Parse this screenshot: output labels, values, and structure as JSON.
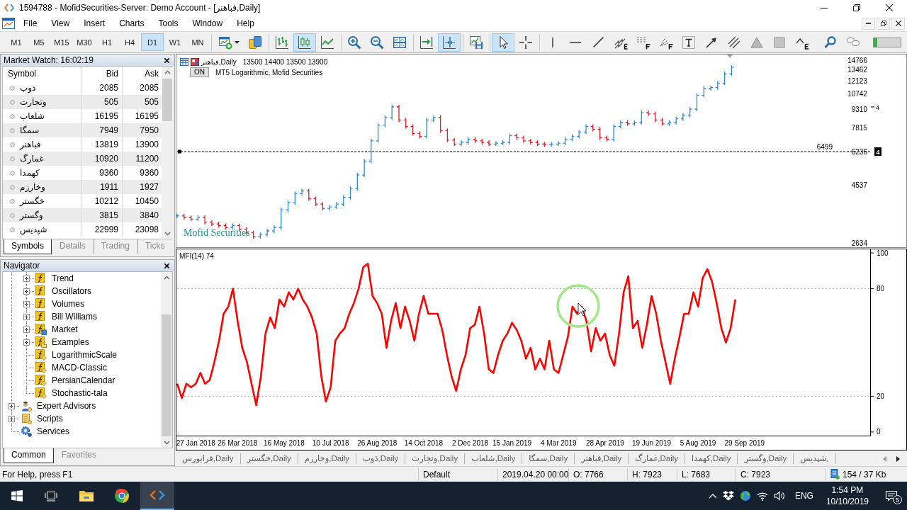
{
  "window": {
    "title": "1594788 - MofidSecurities-Server: Demo Account - [فباهنر,Daily]"
  },
  "menu": [
    "File",
    "View",
    "Insert",
    "Charts",
    "Tools",
    "Window",
    "Help"
  ],
  "toolbar": {
    "timeframes": [
      {
        "label": "M1",
        "selected": false
      },
      {
        "label": "M5",
        "selected": false
      },
      {
        "label": "M15",
        "selected": false
      },
      {
        "label": "M30",
        "selected": false
      },
      {
        "label": "H1",
        "selected": false
      },
      {
        "label": "H4",
        "selected": false
      },
      {
        "label": "D1",
        "selected": true
      },
      {
        "label": "W1",
        "selected": false
      },
      {
        "label": "MN",
        "selected": false
      }
    ],
    "tool_groups": [
      [
        {
          "kind": "new-chart",
          "selected": false
        },
        {
          "kind": "coins",
          "selected": false
        }
      ],
      [
        {
          "kind": "bar-chart",
          "selected": false
        },
        {
          "kind": "candles",
          "selected": true
        },
        {
          "kind": "line-chart",
          "selected": false
        }
      ],
      [
        {
          "kind": "zoom-in",
          "selected": false
        },
        {
          "kind": "zoom-out",
          "selected": false
        },
        {
          "kind": "tile",
          "selected": false
        }
      ],
      [
        {
          "kind": "shift",
          "selected": false
        },
        {
          "kind": "autoscroll",
          "selected": true
        }
      ],
      [
        {
          "kind": "templates",
          "selected": false
        }
      ],
      [
        {
          "kind": "cursor",
          "selected": true
        },
        {
          "kind": "crosshair",
          "selected": false
        }
      ],
      [
        {
          "kind": "vline",
          "selected": false
        },
        {
          "kind": "hline",
          "selected": false
        },
        {
          "kind": "trend",
          "selected": false
        },
        {
          "kind": "channel",
          "selected": false
        },
        {
          "kind": "fibo",
          "selected": false
        },
        {
          "kind": "fan",
          "selected": false
        },
        {
          "kind": "text",
          "selected": false
        },
        {
          "kind": "arrow",
          "selected": false
        },
        {
          "kind": "parallel",
          "selected": false
        },
        {
          "kind": "triangle",
          "selected": false
        },
        {
          "kind": "rectangle",
          "selected": false
        },
        {
          "kind": "elliott",
          "selected": false
        },
        {
          "kind": "search",
          "selected": false
        },
        {
          "kind": "chat",
          "selected": false
        }
      ]
    ]
  },
  "market_watch": {
    "title": "Market Watch: 16:02:19",
    "columns": [
      "Symbol",
      "Bid",
      "Ask"
    ],
    "rows": [
      {
        "symbol": "ذوب",
        "bid": "2085",
        "ask": "2085"
      },
      {
        "symbol": "وتجارت",
        "bid": "505",
        "ask": "505"
      },
      {
        "symbol": "شلعاب",
        "bid": "16195",
        "ask": "16195"
      },
      {
        "symbol": "سمگا",
        "bid": "7949",
        "ask": "7950"
      },
      {
        "symbol": "فباهنر",
        "bid": "13819",
        "ask": "13900"
      },
      {
        "symbol": "غمارگ",
        "bid": "10920",
        "ask": "11200"
      },
      {
        "symbol": "کهمدا",
        "bid": "9360",
        "ask": "9360"
      },
      {
        "symbol": "وخارزم",
        "bid": "1911",
        "ask": "1927"
      },
      {
        "symbol": "خگستر",
        "bid": "10212",
        "ask": "10450"
      },
      {
        "symbol": "وگستر",
        "bid": "3815",
        "ask": "3840"
      },
      {
        "symbol": "شپدیس",
        "bid": "22999",
        "ask": "23098"
      }
    ],
    "tabs": [
      {
        "label": "Symbols",
        "selected": true
      },
      {
        "label": "Details",
        "selected": false
      },
      {
        "label": "Trading",
        "selected": false
      },
      {
        "label": "Ticks",
        "selected": false
      }
    ]
  },
  "navigator": {
    "title": "Navigator",
    "tree": [
      {
        "children": [
          {
            "label": "Trend",
            "kind": "group",
            "expanded": false
          },
          {
            "label": "Oscillators",
            "kind": "group",
            "expanded": false
          },
          {
            "label": "Volumes",
            "kind": "group",
            "expanded": false
          },
          {
            "label": "Bill Williams",
            "kind": "group",
            "expanded": false
          },
          {
            "label": "Market",
            "kind": "market",
            "expanded": false
          },
          {
            "label": "Examples",
            "kind": "folder",
            "expanded": false
          },
          {
            "label": "LogarithmicScale",
            "kind": "indicator"
          },
          {
            "label": "MACD-Classic",
            "kind": "indicator"
          },
          {
            "label": "PersianCalendar",
            "kind": "indicator"
          },
          {
            "label": "Stochastic-tala",
            "kind": "indicator"
          }
        ]
      },
      {
        "label": "Expert Advisors",
        "kind": "experts",
        "expanded": false
      },
      {
        "label": "Scripts",
        "kind": "scripts",
        "expanded": false
      },
      {
        "label": "Services",
        "kind": "services"
      }
    ],
    "tabs": [
      {
        "label": "Common",
        "selected": true
      },
      {
        "label": "Favorites",
        "selected": false
      }
    ]
  },
  "chart": {
    "header": {
      "symbol": "فباهنر,Daily",
      "prices": "13500 14400 13500 13900",
      "button": "ON",
      "indicator": "MT5 Logarithmic, Mofid Securities"
    },
    "label": "Mofid Securities",
    "price_labels": [
      "14766",
      "13462",
      "12123",
      "10742",
      "9310",
      "7815",
      "6236",
      "4537",
      "2634"
    ],
    "line_label": "6499",
    "line_marker": "4",
    "axis_marker": "4"
  },
  "indicator": {
    "label": "MFI(14) 74",
    "chart_data": {
      "type": "line",
      "ylim": [
        -2.2,
        102
      ],
      "yticks": [
        0,
        20,
        80,
        100
      ],
      "ref_lines": [
        {
          "axis": "y",
          "value": 20
        },
        {
          "axis": "y",
          "value": 80
        }
      ],
      "categories": [
        null,
        null,
        null,
        null,
        "27 Jan 2018",
        null,
        null,
        null,
        null,
        null,
        null,
        null,
        null,
        "26 Mar 2018",
        null,
        null,
        null,
        null,
        null,
        null,
        null,
        null,
        null,
        "16 May 2018",
        null,
        null,
        null,
        null,
        null,
        null,
        null,
        null,
        null,
        "10 Jul 2018",
        null,
        null,
        null,
        null,
        null,
        null,
        null,
        null,
        null,
        "26 Aug 2018",
        null,
        null,
        null,
        null,
        null,
        null,
        null,
        null,
        null,
        "14 Oct 2018",
        null,
        null,
        null,
        null,
        null,
        null,
        null,
        null,
        null,
        "2 Dec 2018",
        null,
        null,
        null,
        null,
        null,
        null,
        null,
        null,
        "15 Jan 2019",
        null,
        null,
        null,
        null,
        null,
        null,
        null,
        null,
        null,
        "4 Mar 2019",
        null,
        null,
        null,
        null,
        null,
        null,
        null,
        null,
        null,
        "28 Apr 2019",
        null,
        null,
        null,
        null,
        null,
        null,
        null,
        null,
        null,
        "19 Jun 2019",
        null,
        null,
        null,
        null,
        null,
        null,
        null,
        null,
        null,
        "5 Aug 2019",
        null,
        null,
        null,
        null,
        null,
        null,
        null,
        null,
        null,
        "29 Sep 2019",
        null,
        null,
        null,
        null,
        null,
        null,
        null,
        null,
        null,
        null,
        null,
        null,
        null,
        null,
        null,
        null,
        null,
        null,
        null,
        null,
        null,
        null,
        null,
        null,
        null,
        null,
        null
      ],
      "series": [
        {
          "color": "#ff0000",
          "values": [
            27,
            19,
            27,
            25,
            27,
            33,
            27,
            29,
            39,
            51,
            66,
            70,
            80,
            62,
            47,
            39,
            27,
            15,
            31,
            55,
            64,
            58,
            74,
            70,
            78,
            74,
            80,
            74,
            70,
            64,
            55,
            31,
            17,
            25,
            51,
            55,
            58,
            66,
            72,
            80,
            92,
            94,
            76,
            72,
            66,
            47,
            62,
            72,
            58,
            70,
            62,
            51,
            66,
            76,
            66,
            66,
            66,
            57,
            43,
            31,
            23,
            35,
            43,
            58,
            60,
            70,
            55,
            35,
            33,
            43,
            51,
            55,
            61,
            57,
            51,
            41,
            47,
            35,
            41,
            35,
            51,
            35,
            33,
            43,
            53,
            70,
            66,
            70,
            62,
            45,
            58,
            51,
            55,
            43,
            37,
            55,
            78,
            87,
            58,
            62,
            47,
            60,
            76,
            66,
            51,
            39,
            27,
            41,
            53,
            66,
            66,
            78,
            70,
            86,
            91,
            84,
            72,
            58,
            50,
            58,
            74,
            null,
            null,
            null,
            null,
            null,
            null,
            null,
            null,
            null,
            null,
            null,
            null,
            null,
            null,
            null,
            null,
            null,
            null,
            null,
            null,
            null,
            null,
            null,
            null,
            null,
            null,
            null,
            null,
            null
          ]
        }
      ]
    }
  },
  "chart_tabs": [
    "فرابورس,Daily",
    "خگستر,Daily",
    "وخارزم,Daily",
    "ذوب,Daily",
    "وتجارت,Daily",
    "شلعاب,Daily",
    "سمگا,Daily",
    "فباهنر,Daily",
    "غمارگ,Daily",
    "کهمدا,Daily",
    "وگستر,Daily",
    "شپدیس,"
  ],
  "status_bar": {
    "help": "For Help, press F1",
    "profile": "Default",
    "time": "2019.04.20 00:00",
    "open": "O: 7766",
    "high": "H: 7923",
    "low": "L: 7683",
    "close": "C: 7923",
    "traffic": "154 / 37 Kb"
  },
  "taskbar": {
    "apps": [
      {
        "kind": "explorer",
        "selected": false
      },
      {
        "kind": "browser",
        "selected": false
      },
      {
        "kind": "terminal",
        "selected": true
      }
    ],
    "language": "ENG",
    "time": "1:54 PM",
    "date": "10/10/2019",
    "notifications": "5"
  }
}
